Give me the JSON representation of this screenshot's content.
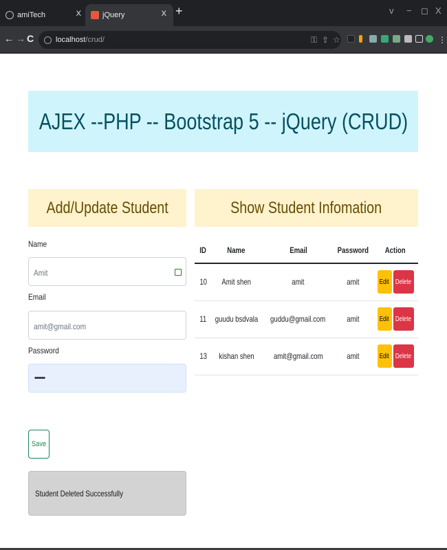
{
  "browser": {
    "tabs": [
      {
        "title": "amiTech",
        "close": "X"
      },
      {
        "title": "jQuery",
        "close": "X"
      }
    ],
    "new_tab": "+",
    "window_controls": [
      "v",
      "−",
      "◻",
      "X"
    ],
    "nav": {
      "back": "←",
      "forward": "→",
      "reload": "C"
    },
    "url": {
      "host": "localhost",
      "path": "/crud/"
    }
  },
  "page": {
    "banner_title": "AJEX --PHP -- Bootstrap 5 -- jQuery (CRUD)",
    "form": {
      "heading": "Add/Update Student",
      "name_label": "Name",
      "name_placeholder": "Amit",
      "email_label": "Email",
      "email_placeholder": "amit@gmail.com",
      "password_label": "Password",
      "password_value": "••••••",
      "save_label": "Save",
      "alert_message": "Student Deleted Successfully"
    },
    "table": {
      "heading": "Show Student Infomation",
      "columns": [
        "ID",
        "Name",
        "Email",
        "Password",
        "Action"
      ],
      "edit_label": "Edit",
      "delete_label": "Delete",
      "rows": [
        {
          "id": "10",
          "name": "Amit shen",
          "email": "amit",
          "password": "amit"
        },
        {
          "id": "11",
          "name": "guudu bsdvala",
          "email": "guddu@gmail.com",
          "password": "amit"
        },
        {
          "id": "13",
          "name": "kishan shen",
          "email": "amit@gmail.com",
          "password": "amit"
        }
      ]
    }
  },
  "colors": {
    "banner_bg": "#cff4fc",
    "banner_text": "#055160",
    "heading_bg": "#fff3cd",
    "heading_text": "#664d03",
    "edit_btn": "#ffc107",
    "delete_btn": "#dc3545",
    "save_btn": "#198754"
  }
}
